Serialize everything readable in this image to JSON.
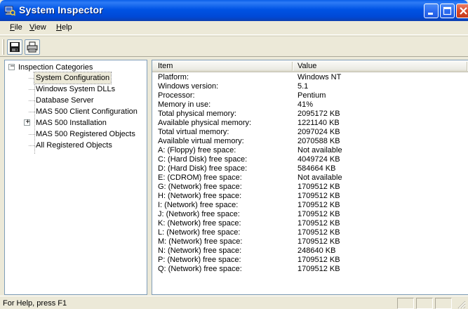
{
  "window": {
    "title": "System Inspector",
    "title_bar_color": "#0054e3",
    "close_button_color": "#d9492a"
  },
  "menu": {
    "file": "File",
    "view": "View",
    "help": "Help"
  },
  "toolbar": {
    "save_icon": "floppy-disk-icon",
    "print_icon": "printer-icon"
  },
  "tree": {
    "root_label": "Inspection Categories",
    "items": [
      {
        "label": "System Configuration",
        "selected": true,
        "expandable": false
      },
      {
        "label": "Windows System DLLs",
        "selected": false,
        "expandable": false
      },
      {
        "label": "Database Server",
        "selected": false,
        "expandable": false
      },
      {
        "label": "MAS 500 Client Configuration",
        "selected": false,
        "expandable": false
      },
      {
        "label": "MAS 500 Installation",
        "selected": false,
        "expandable": true
      },
      {
        "label": "MAS 500 Registered Objects",
        "selected": false,
        "expandable": false
      },
      {
        "label": "All Registered Objects",
        "selected": false,
        "expandable": false
      }
    ]
  },
  "list": {
    "columns": [
      "Item",
      "Value"
    ],
    "rows": [
      [
        "Platform:",
        "Windows NT"
      ],
      [
        "Windows version:",
        "5.1"
      ],
      [
        "Processor:",
        "Pentium"
      ],
      [
        "Memory in use:",
        "41%"
      ],
      [
        "Total physical memory:",
        "2095172 KB"
      ],
      [
        "Available physical memory:",
        "1221140 KB"
      ],
      [
        "Total virtual memory:",
        "2097024 KB"
      ],
      [
        "Available virtual memory:",
        "2070588 KB"
      ],
      [
        "A: (Floppy) free space:",
        "Not available"
      ],
      [
        "C: (Hard Disk) free space:",
        "4049724 KB"
      ],
      [
        "D: (Hard Disk) free space:",
        "584664 KB"
      ],
      [
        "E: (CDROM) free space:",
        "Not available"
      ],
      [
        "G: (Network) free space:",
        "1709512 KB"
      ],
      [
        "H: (Network) free space:",
        "1709512 KB"
      ],
      [
        "I: (Network) free space:",
        "1709512 KB"
      ],
      [
        "J: (Network) free space:",
        "1709512 KB"
      ],
      [
        "K: (Network) free space:",
        "1709512 KB"
      ],
      [
        "L: (Network) free space:",
        "1709512 KB"
      ],
      [
        "M: (Network) free space:",
        "1709512 KB"
      ],
      [
        "N: (Network) free space:",
        "248640 KB"
      ],
      [
        "P: (Network) free space:",
        "1709512 KB"
      ],
      [
        "Q: (Network) free space:",
        "1709512 KB"
      ]
    ]
  },
  "status": {
    "text": "For Help, press F1"
  }
}
